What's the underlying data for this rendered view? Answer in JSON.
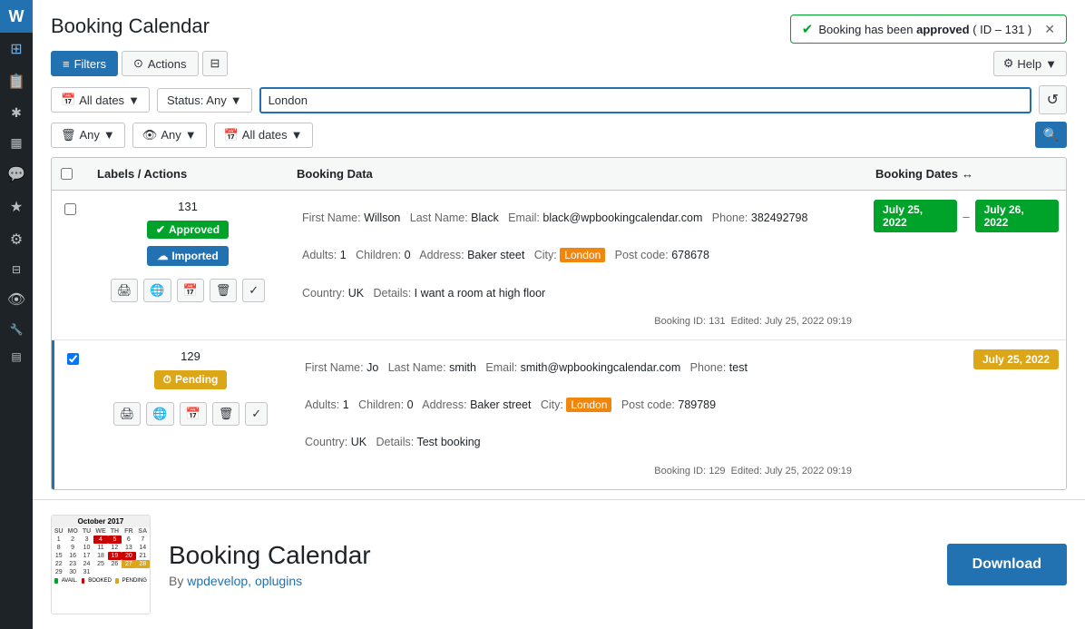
{
  "sidebar": {
    "icons": [
      {
        "name": "dashboard-icon",
        "glyph": "⊞"
      },
      {
        "name": "booking-icon",
        "glyph": "📅"
      },
      {
        "name": "tools-icon",
        "glyph": "🔧"
      },
      {
        "name": "calendar-icon",
        "glyph": "📆"
      },
      {
        "name": "comment-icon",
        "glyph": "💬"
      },
      {
        "name": "star-icon",
        "glyph": "★"
      },
      {
        "name": "settings-icon",
        "glyph": "⚙"
      },
      {
        "name": "plugin-icon",
        "glyph": "🔌"
      },
      {
        "name": "eye-icon",
        "glyph": "👁"
      },
      {
        "name": "wrench-icon",
        "glyph": "🔩"
      },
      {
        "name": "grid-icon",
        "glyph": "⊟"
      }
    ]
  },
  "header": {
    "title": "Booking Calendar"
  },
  "notification": {
    "message": "Booking has been",
    "bold_part": "approved",
    "id_part": "( ID – 131 )"
  },
  "toolbar": {
    "filters_label": "Filters",
    "actions_label": "Actions",
    "help_label": "Help"
  },
  "filters": {
    "date_label": "All dates",
    "status_label": "Status: Any",
    "search_value": "London",
    "any1_label": "Any",
    "any2_label": "Any",
    "all_dates2_label": "All dates"
  },
  "table": {
    "col_labels": "Labels / Actions",
    "col_data": "Booking Data",
    "col_dates": "Booking Dates",
    "bookings": [
      {
        "id": "131",
        "status": "Approved",
        "status_class": "approved",
        "imported": true,
        "imported_label": "Imported",
        "first_name_label": "First Name:",
        "first_name": "Willson",
        "last_name_label": "Last Name:",
        "last_name": "Black",
        "email_label": "Email:",
        "email": "black@wpbookingcalendar.com",
        "phone_label": "Phone:",
        "phone": "382492798",
        "adults_label": "Adults:",
        "adults": "1",
        "children_label": "Children:",
        "children": "0",
        "address_label": "Address:",
        "address": "Baker steet",
        "city_label": "City:",
        "city": "London",
        "postcode_label": "Post code:",
        "postcode": "678678",
        "country_label": "Country:",
        "country": "UK",
        "details_label": "Details:",
        "details": "I want a room at high floor",
        "date_from": "July 25, 2022",
        "date_to": "July 26, 2022",
        "date_from_class": "approved",
        "date_to_class": "approved",
        "meta": "Booking ID: 131  Edited: July 25, 2022 09:19",
        "highlighted": false
      },
      {
        "id": "129",
        "status": "Pending",
        "status_class": "pending",
        "imported": false,
        "first_name_label": "First Name:",
        "first_name": "Jo",
        "last_name_label": "Last Name:",
        "last_name": "smith",
        "email_label": "Email:",
        "email": "smith@wpbookingcalendar.com",
        "phone_label": "Phone:",
        "phone": "test",
        "adults_label": "Adults:",
        "adults": "1",
        "children_label": "Children:",
        "children": "0",
        "address_label": "Address:",
        "address": "Baker street",
        "city_label": "City:",
        "city": "London",
        "postcode_label": "Post code:",
        "postcode": "789789",
        "country_label": "Country:",
        "country": "UK",
        "details_label": "Details:",
        "details": "Test booking",
        "date_from": "July 25, 2022",
        "date_to": null,
        "date_from_class": "pending-date",
        "meta": "Booking ID: 129  Edited: July 25, 2022 09:19",
        "highlighted": true
      }
    ]
  },
  "plugin": {
    "title": "Booking Calendar",
    "author_prefix": "By ",
    "author_name": "wpdevelop, oplugins",
    "author_url": "#",
    "download_label": "Download"
  },
  "mini_calendar": {
    "month": "October 2017",
    "day_headers": [
      "SU",
      "MO",
      "TU",
      "WE",
      "TH",
      "FR",
      "SA"
    ],
    "days": [
      {
        "n": "1",
        "class": ""
      },
      {
        "n": "2",
        "class": ""
      },
      {
        "n": "3",
        "class": ""
      },
      {
        "n": "4",
        "class": "booked"
      },
      {
        "n": "5",
        "class": "booked"
      },
      {
        "n": "6",
        "class": ""
      },
      {
        "n": "7",
        "class": ""
      },
      {
        "n": "8",
        "class": ""
      },
      {
        "n": "9",
        "class": ""
      },
      {
        "n": "10",
        "class": ""
      },
      {
        "n": "11",
        "class": ""
      },
      {
        "n": "12",
        "class": ""
      },
      {
        "n": "13",
        "class": ""
      },
      {
        "n": "14",
        "class": ""
      },
      {
        "n": "15",
        "class": ""
      },
      {
        "n": "16",
        "class": ""
      },
      {
        "n": "17",
        "class": ""
      },
      {
        "n": "18",
        "class": ""
      },
      {
        "n": "19",
        "class": "booked"
      },
      {
        "n": "20",
        "class": "booked"
      },
      {
        "n": "21",
        "class": ""
      },
      {
        "n": "22",
        "class": ""
      },
      {
        "n": "23",
        "class": ""
      },
      {
        "n": "24",
        "class": ""
      },
      {
        "n": "25",
        "class": ""
      },
      {
        "n": "26",
        "class": ""
      },
      {
        "n": "27",
        "class": "pending-day"
      },
      {
        "n": "28",
        "class": "pending-day"
      },
      {
        "n": "29",
        "class": ""
      },
      {
        "n": "30",
        "class": ""
      },
      {
        "n": "31",
        "class": "",
        "empty": true
      }
    ]
  }
}
